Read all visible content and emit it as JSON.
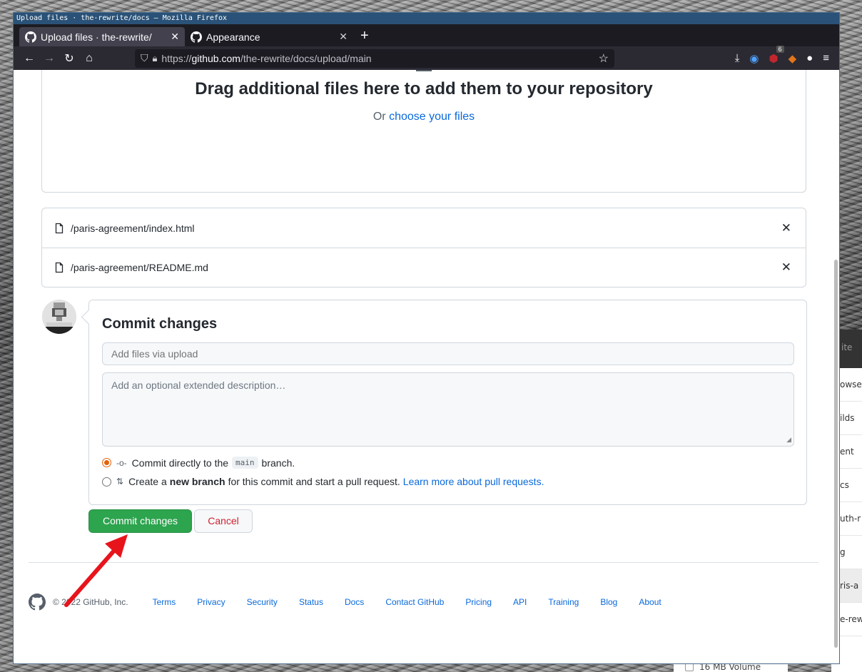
{
  "window": {
    "title": "Upload files · the-rewrite/docs — Mozilla Firefox"
  },
  "tabs": [
    {
      "label": "Upload files · the-rewrite/",
      "icon": "github-icon",
      "active": true
    },
    {
      "label": "Appearance",
      "icon": "github-icon",
      "active": false
    }
  ],
  "toolbar": {
    "url_prefix": "https://",
    "url_domain": "github.com",
    "url_path": "/the-rewrite/docs/upload/main",
    "ublock_count": "6"
  },
  "dropzone": {
    "heading": "Drag additional files here to add them to your repository",
    "or_text": "Or",
    "choose_link": "choose your files"
  },
  "files": [
    {
      "name": "/paris-agreement/index.html"
    },
    {
      "name": "/paris-agreement/README.md"
    }
  ],
  "commit": {
    "heading": "Commit changes",
    "summary_placeholder": "Add files via upload",
    "description_placeholder": "Add an optional extended description…",
    "option_direct_pre": "Commit directly to the",
    "option_direct_branch": "main",
    "option_direct_post": "branch.",
    "option_new_pre": "Create a",
    "option_new_bold": "new branch",
    "option_new_post": "for this commit and start a pull request.",
    "option_new_link": "Learn more about pull requests.",
    "commit_button": "Commit changes",
    "cancel_button": "Cancel"
  },
  "footer": {
    "copyright": "© 2022 GitHub, Inc.",
    "links": [
      "Terms",
      "Privacy",
      "Security",
      "Status",
      "Docs",
      "Contact GitHub",
      "Pricing",
      "API",
      "Training",
      "Blog",
      "About"
    ]
  },
  "background_window": {
    "header": "ite",
    "rows": [
      "owse",
      "ilds",
      "ent",
      "cs",
      "uth-r",
      "g",
      "ris-a",
      "e-rew"
    ],
    "bottom_item": "16 MB Volume"
  },
  "colors": {
    "primary_green": "#2da44e",
    "link_blue": "#0969da",
    "cancel_red": "#cf222e",
    "radio_orange": "#e36209",
    "annotation_arrow": "#e8141c"
  }
}
